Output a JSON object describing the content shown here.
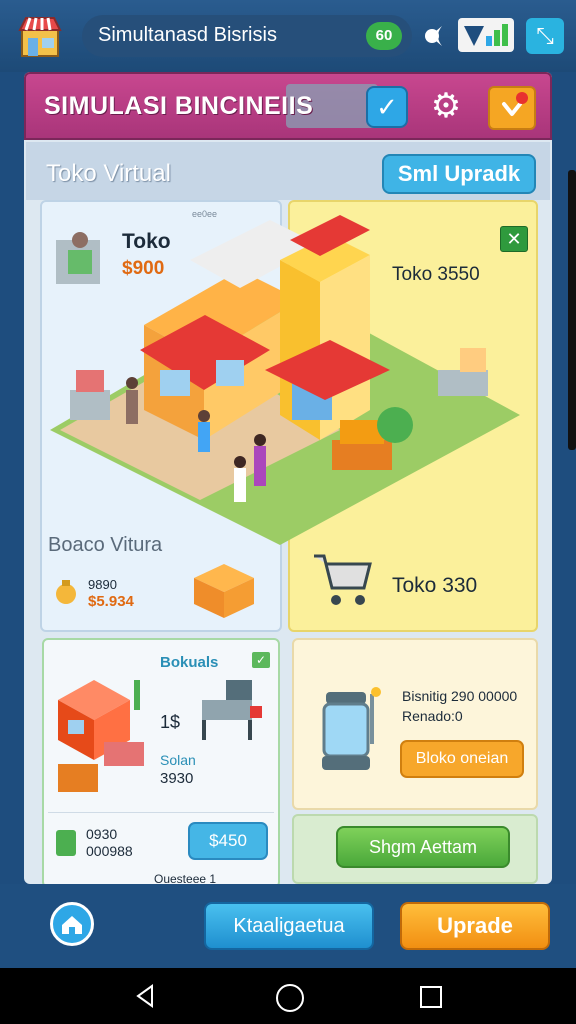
{
  "topbar": {
    "app_title": "Simultanasd Bisrisis",
    "coin_badge": "60",
    "expand_icon": "expand-icon"
  },
  "header": {
    "title": "SIMULASI BINCINEIIS",
    "check_icon": "check-icon",
    "gear_icon": "gear-icon",
    "heart_icon": "heart-icon"
  },
  "subheader": {
    "title": "Toko Virtual",
    "upgrade_label": "Sml Upradk"
  },
  "scene": {
    "tiny_label": "ee0ee",
    "toko_label": "Toko",
    "toko_price": "$900",
    "toko_right_1": "Toko 3550",
    "toko_right_2": "Toko 330",
    "boaco_label": "Boaco Vitura",
    "boaco_stat_1": "9890",
    "boaco_stat_2": "$5.934"
  },
  "lower_left": {
    "bokuals_label": "Bokuals",
    "one_s_label": "1$",
    "solan_label": "Solan",
    "solan_value": "3930",
    "coin_stat_1": "0930",
    "coin_stat_2": "000988",
    "price_button": "$450",
    "partial_label": "Ouesteee 1"
  },
  "lower_right": {
    "bisnis_line_1": "Bisnitig 290 00000",
    "bisnis_line_2": "Renado:0",
    "orange_button": "Bloko oneian"
  },
  "green_panel": {
    "action_label": "Shgm Aettam"
  },
  "bottom": {
    "catalog_label": "Ktaaligaetua",
    "upgrade_label": "Uprade"
  },
  "colors": {
    "header": "#c8478f",
    "accent_blue": "#2ea7e6",
    "accent_orange": "#f7a72b",
    "accent_green": "#4aa83a"
  }
}
